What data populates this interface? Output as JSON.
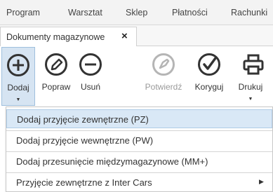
{
  "menubar": {
    "items": [
      "Program",
      "Warsztat",
      "Sklep",
      "Płatności",
      "Rachunki"
    ]
  },
  "tab": {
    "label": "Dokumenty magazynowe",
    "close": "×"
  },
  "toolbar": {
    "add_label": "Dodaj",
    "edit_label": "Popraw",
    "delete_label": "Usuń",
    "confirm_label": "Potwierdź",
    "correct_label": "Koryguj",
    "print_label": "Drukuj",
    "dropdown_arrow": "▼"
  },
  "dropdown": {
    "items": [
      "Dodaj przyjęcie zewnętrzne (PZ)",
      "Dodaj przyjęcie wewnętrzne (PW)",
      "Dodaj przesunięcie międzymagazynowe (MM+)",
      "Przyjęcie zewnętrzne z Inter Cars"
    ],
    "submenu_arrow": "▶"
  },
  "colors": {
    "accent": "#d9e8f6",
    "icon": "#333333",
    "icon_disabled": "#b5b5b5"
  }
}
